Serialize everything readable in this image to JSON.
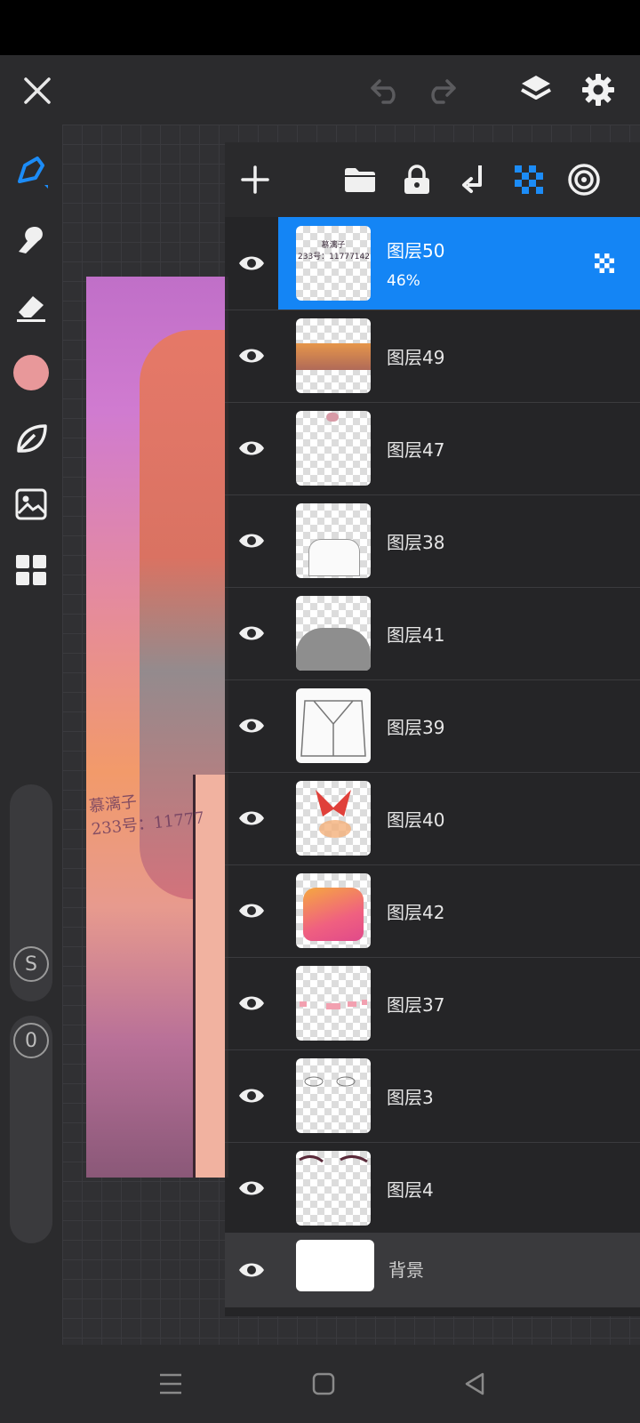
{
  "colors": {
    "accent": "#1485f5",
    "current_color": "#e8989a"
  },
  "toolbar": {
    "close_icon": "close-icon",
    "undo_icon": "undo-icon",
    "redo_icon": "redo-icon",
    "layers_icon": "layers-icon",
    "settings_icon": "gear-icon"
  },
  "sidebar": {
    "tools": [
      "pen-icon",
      "smudge-icon",
      "eraser-icon",
      "color-swatch",
      "leaf-icon",
      "image-import-icon",
      "grid-icon"
    ],
    "size_label": "S",
    "opacity_label": "0"
  },
  "artwork": {
    "signature": "慕漓子\n233号：11777"
  },
  "layers_toolbar": {
    "add_icon": "plus-icon",
    "folder_icon": "folder-icon",
    "lock_icon": "lock-icon",
    "merge_down_icon": "merge-down-icon",
    "blend_icon": "checker-icon",
    "more_icon": "ring-icon"
  },
  "layers": [
    {
      "name": "图层50",
      "opacity": "46%",
      "selected": true,
      "thumb_text": "慕漓子\n233号：11777142"
    },
    {
      "name": "图层49"
    },
    {
      "name": "图层47"
    },
    {
      "name": "图层38"
    },
    {
      "name": "图层41"
    },
    {
      "name": "图层39"
    },
    {
      "name": "图层40"
    },
    {
      "name": "图层42"
    },
    {
      "name": "图层37"
    },
    {
      "name": "图层3"
    },
    {
      "name": "图层4"
    }
  ],
  "background_layer": {
    "name": "背景"
  },
  "navbar": {
    "menu_icon": "menu-icon",
    "home_icon": "home-icon",
    "back_icon": "back-icon"
  }
}
